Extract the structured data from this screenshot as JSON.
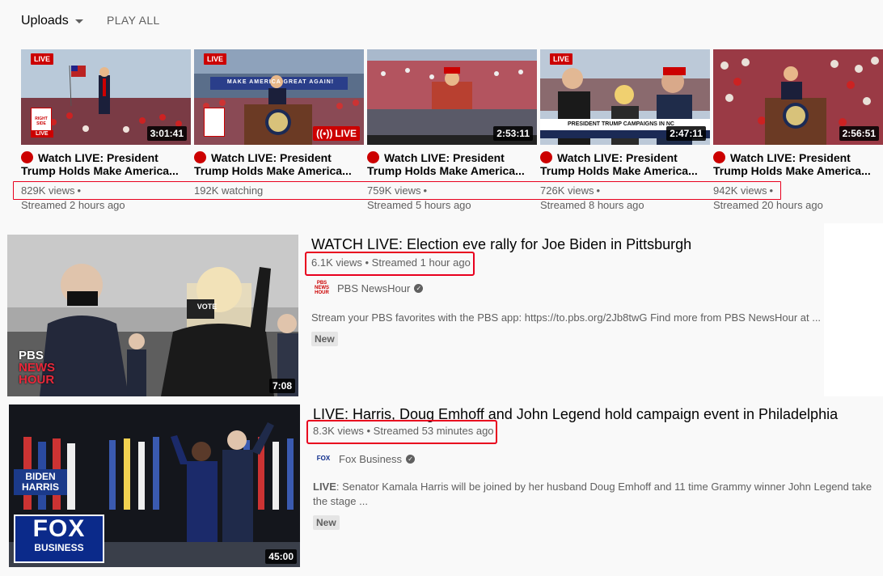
{
  "header": {
    "uploads_label": "Uploads",
    "play_all_label": "PLAY ALL"
  },
  "shelf": [
    {
      "title": "Watch LIVE: President Trump Holds Make America...",
      "views": "829K views",
      "time": "Streamed 2 hours ago",
      "badge_text": "3:01:41",
      "live_tag": "LIVE"
    },
    {
      "title": "Watch LIVE: President Trump Holds Make America...",
      "views": "192K watching",
      "time": "",
      "badge_text": "LIVE",
      "live_tag": "LIVE"
    },
    {
      "title": "Watch LIVE: President Trump Holds Make America...",
      "views": "759K views",
      "time": "Streamed 5 hours ago",
      "badge_text": "2:53:11",
      "live_tag": ""
    },
    {
      "title": "Watch LIVE: President Trump Holds Make America...",
      "views": "726K views",
      "time": "Streamed 8 hours ago",
      "badge_text": "2:47:11",
      "live_tag": "LIVE"
    },
    {
      "title": "Watch LIVE: President Trump Holds Make America...",
      "views": "942K views",
      "time": "Streamed 20 hours ago",
      "badge_text": "2:56:51",
      "live_tag": ""
    }
  ],
  "thumb_text": {
    "t1_logo": "RIGHT SIDE",
    "t1_live": "LIVE",
    "t2_banner": "MAKE AMERICA GREAT AGAIN!",
    "t4_banner": "PRESIDENT TRUMP CAMPAIGNS IN NC"
  },
  "videos": [
    {
      "title": "WATCH LIVE: Election eve rally for Joe Biden in Pittsburgh",
      "views": "6.1K views",
      "time": "Streamed 1 hour ago",
      "channel": "PBS NewsHour",
      "channel_logo": "PBS NEWS HOUR",
      "description": "Stream your PBS favorites with the PBS app: https://to.pbs.org/2Jb8twG Find more from PBS NewsHour at ...",
      "badge": "New",
      "duration": "7:08",
      "thumb_logo_top": "PBS",
      "thumb_logo_mid": "NEWS",
      "thumb_logo_bot": "HOUR",
      "thumb_sign": "VOTE"
    },
    {
      "title": "LIVE: Harris, Doug Emhoff and John Legend hold campaign event in Philadelphia",
      "views": "8.3K views",
      "time": "Streamed 53 minutes ago",
      "channel": "Fox Business",
      "channel_logo": "FOX",
      "description_bold": "LIVE",
      "description": ": Senator Kamala Harris will be joined by her husband Doug Emhoff and 11 time Grammy winner John Legend take the stage ...",
      "badge": "New",
      "duration": "45:00",
      "thumb_logo_top": "FOX",
      "thumb_logo_bot": "BUSINESS",
      "thumb_sign_top": "BIDEN",
      "thumb_sign_bot": "HARRIS"
    }
  ],
  "colors": {
    "highlight": "#e8001e",
    "live_red": "#cc0000",
    "meta_grey": "#606060"
  }
}
